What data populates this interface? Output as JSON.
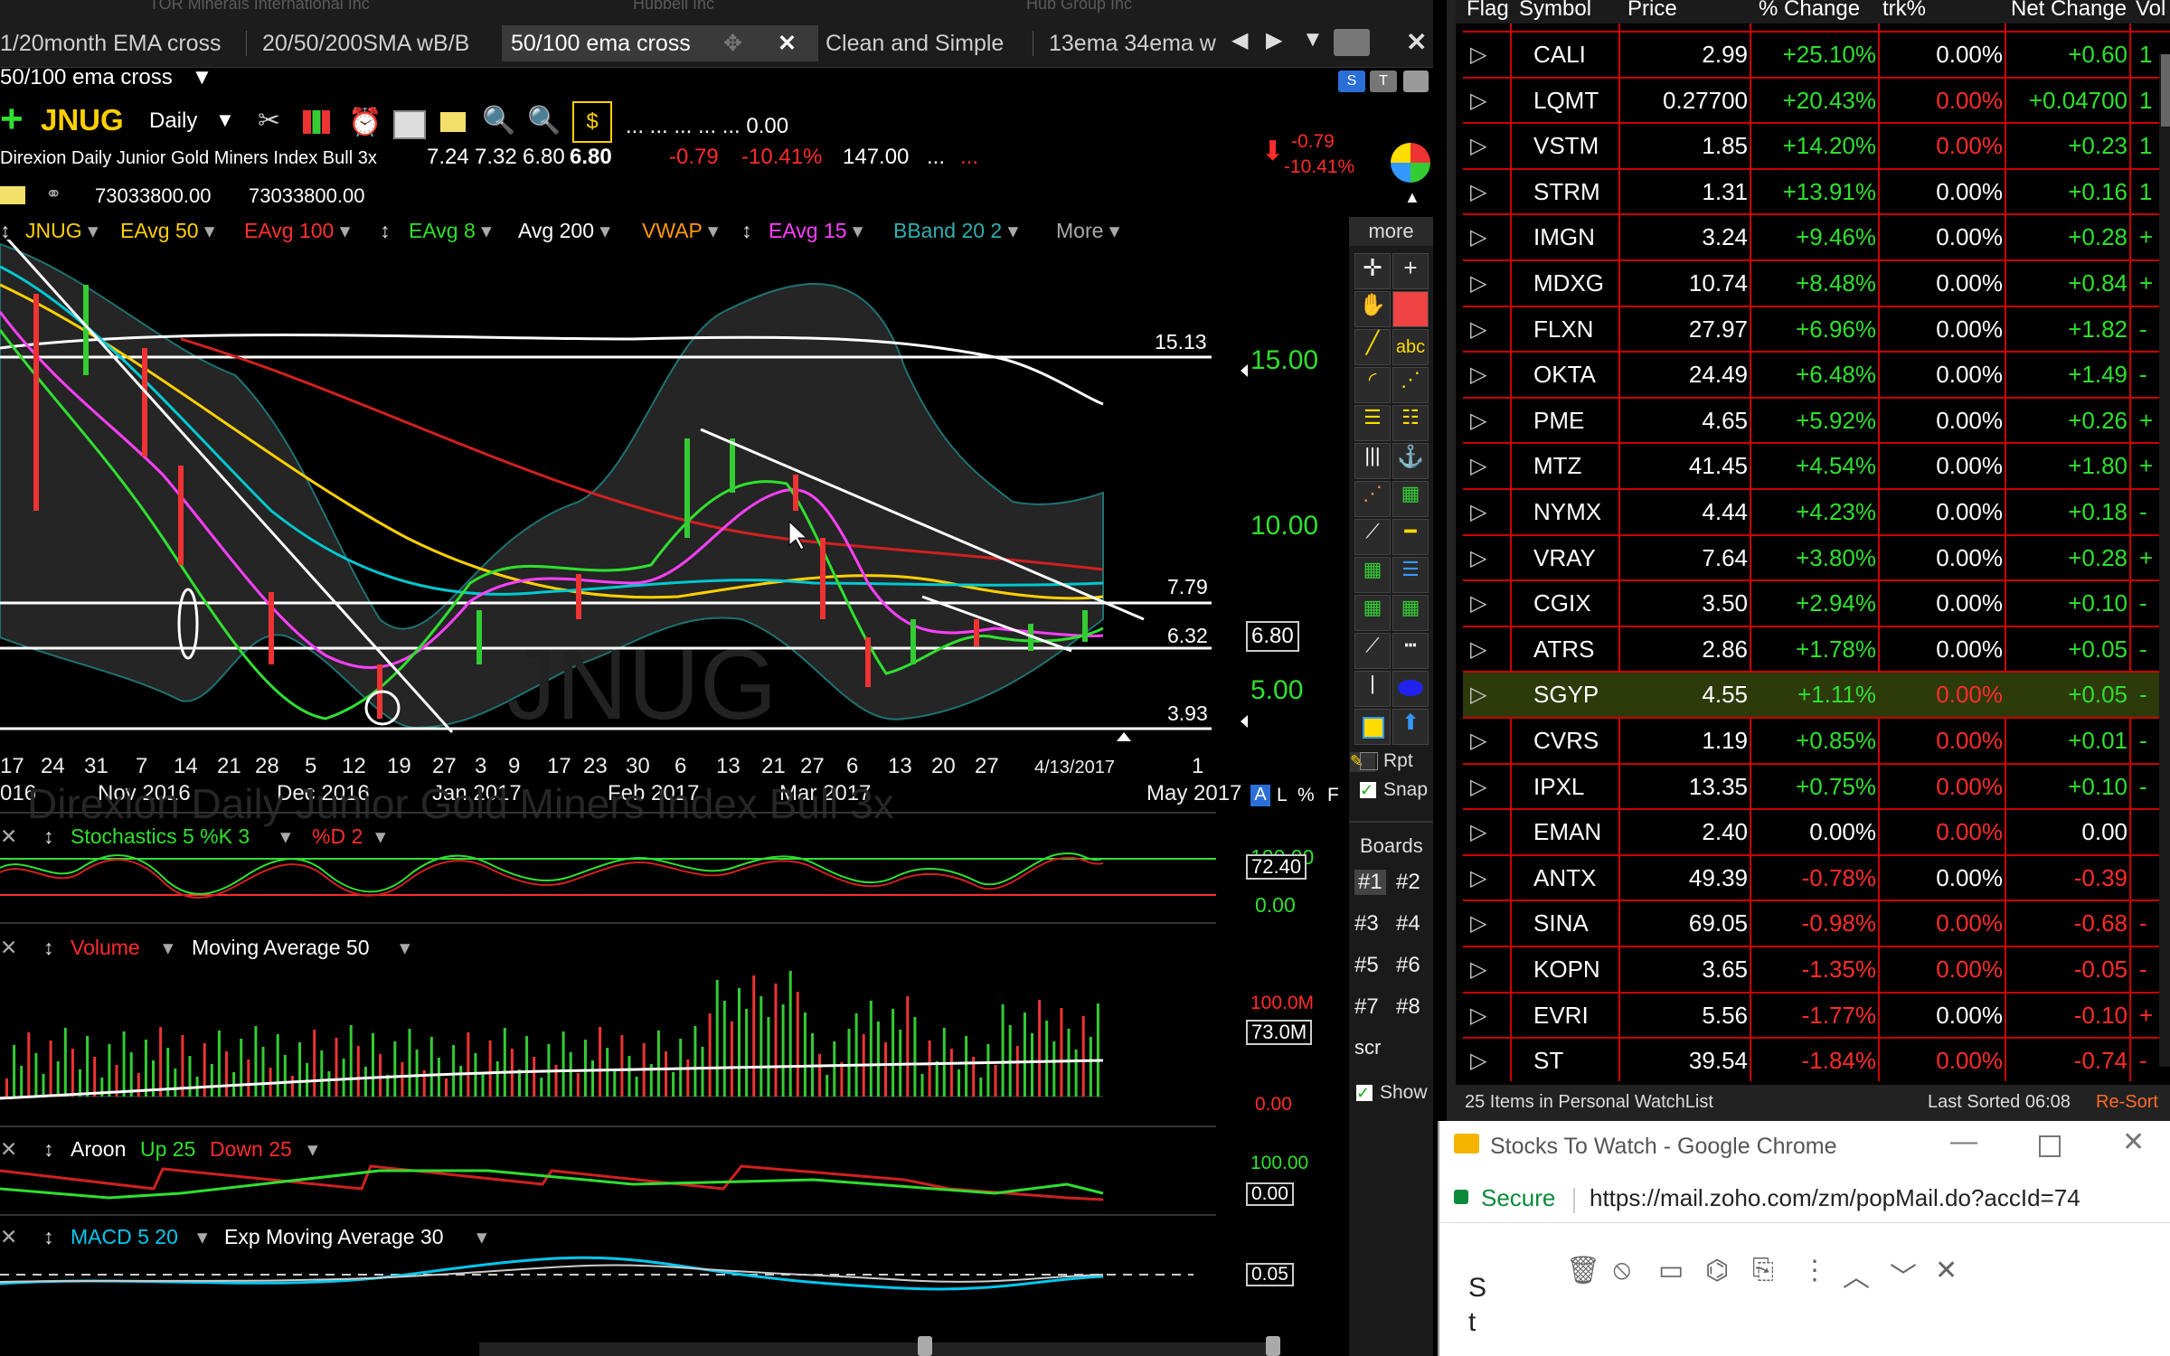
{
  "tabbar": {
    "ghost_titles": [
      "TOR Minerals International Inc",
      "Hubbell Inc",
      "Hub Group Inc"
    ],
    "tabs": [
      {
        "label": "1/20month EMA cross"
      },
      {
        "label": "20/50/200SMA wB/B"
      },
      {
        "label": "50/100 ema cross"
      },
      {
        "label": "Clean and Simple"
      },
      {
        "label": "13ema 34ema w"
      }
    ],
    "tab_close": "✕",
    "nav_prev": "◀",
    "nav_next": "▶",
    "nav_menu": "▼",
    "window_close": "✕"
  },
  "layout_name": "50/100 ema cross",
  "symbol": {
    "ticker": "JNUG",
    "interval": "Daily",
    "ohlc_placeholder": "... ... ... ... ... 0.00",
    "name": "Direxion Daily Junior Gold Miners Index Bull 3x",
    "open": "7.24",
    "high": "7.32",
    "low": "6.80",
    "last": "6.80",
    "change": "-0.79",
    "change_pct": "-10.41%",
    "prev": "147.00",
    "dots": "...",
    "dots_red": "...",
    "volume_a": "73033800.00",
    "volume_b": "73033800.00",
    "badge_change": "-0.79",
    "badge_change_pct": "-10.41%",
    "watermark": "JNUG",
    "watermark_name": "Direxion Daily Junior Gold Miners Index Bull 3x"
  },
  "indicators": [
    {
      "label": "JNUG",
      "color": "#ffd000"
    },
    {
      "label": "EAvg 50",
      "color": "#ffd000"
    },
    {
      "label": "EAvg 100",
      "color": "#ff3030"
    },
    {
      "label": "EAvg 8",
      "color": "#30e030"
    },
    {
      "label": "Avg 200",
      "color": "#ffffff"
    },
    {
      "label": "VWAP",
      "color": "#ff9a00"
    },
    {
      "label": "EAvg 15",
      "color": "#ff40ff"
    },
    {
      "label": "BBand 20 2",
      "color": "#2fb0b0"
    },
    {
      "label": "More",
      "color": "#aaaaaa"
    }
  ],
  "price_axis": {
    "labels": [
      "15.00",
      "10.00",
      "5.00"
    ],
    "level_15_13": "15.13",
    "level_7_79": "7.79",
    "level_6_32": "6.32",
    "level_3_93": "3.93",
    "last_box": "6.80"
  },
  "dates_row1": [
    "17",
    "24",
    "31",
    "7",
    "14",
    "21",
    "28",
    "5",
    "12",
    "19",
    "27",
    "3",
    "9",
    "17",
    "23",
    "30",
    "6",
    "13",
    "21",
    "27",
    "6",
    "13",
    "20",
    "27",
    "4/13/2017",
    "1"
  ],
  "dates_row2": [
    "016",
    "Nov 2016",
    "Dec 2016",
    "Jan 2017",
    "Feb 2017",
    "Mar 2017",
    "May 2017"
  ],
  "axis_modes": {
    "a": "A",
    "l": "L",
    "pct": "%",
    "f": "F"
  },
  "stochastics": {
    "label": "Stochastics 5 %K 3",
    "d_label": "%D 2",
    "top": "100.00",
    "current": "72.40",
    "bottom": "0.00"
  },
  "volume": {
    "label": "Volume",
    "ma_label": "Moving Average 50",
    "top": "100.0M",
    "current": "73.0M",
    "bottom": "0.00"
  },
  "aroon": {
    "label": "Aroon",
    "up": "Up 25",
    "down": "Down 25",
    "top": "100.00",
    "current": "0.00",
    "bottom": "0.00"
  },
  "macd": {
    "label": "MACD 5 20",
    "ema_label": "Exp Moving Average 30",
    "current": "0.05"
  },
  "tools": {
    "more": "more",
    "rpt": "Rpt",
    "snap": "Snap",
    "boards": "Boards",
    "show": "Show",
    "scr": "scr",
    "abc": "abc",
    "board_items": [
      "#1",
      "#2",
      "#3",
      "#4",
      "#5",
      "#6",
      "#7",
      "#8"
    ]
  },
  "watchlist": {
    "headers": [
      "Flag",
      "Symbol",
      "Price",
      "% Change",
      "trk%",
      "Net Change",
      "Vol"
    ],
    "rows": [
      {
        "symbol": "CALI",
        "price": "2.99",
        "pct": "+25.10%",
        "trk": "0.00%",
        "trk_red": false,
        "net": "+0.60",
        "tail": "1"
      },
      {
        "symbol": "LQMT",
        "price": "0.27700",
        "pct": "+20.43%",
        "trk": "0.00%",
        "trk_red": true,
        "net": "+0.04700",
        "tail": "1"
      },
      {
        "symbol": "VSTM",
        "price": "1.85",
        "pct": "+14.20%",
        "trk": "0.00%",
        "trk_red": true,
        "net": "+0.23",
        "tail": "1"
      },
      {
        "symbol": "STRM",
        "price": "1.31",
        "pct": "+13.91%",
        "trk": "0.00%",
        "trk_red": false,
        "net": "+0.16",
        "tail": "1"
      },
      {
        "symbol": "IMGN",
        "price": "3.24",
        "pct": "+9.46%",
        "trk": "0.00%",
        "trk_red": false,
        "net": "+0.28",
        "tail": "+"
      },
      {
        "symbol": "MDXG",
        "price": "10.74",
        "pct": "+8.48%",
        "trk": "0.00%",
        "trk_red": false,
        "net": "+0.84",
        "tail": "+"
      },
      {
        "symbol": "FLXN",
        "price": "27.97",
        "pct": "+6.96%",
        "trk": "0.00%",
        "trk_red": false,
        "net": "+1.82",
        "tail": "-"
      },
      {
        "symbol": "OKTA",
        "price": "24.49",
        "pct": "+6.48%",
        "trk": "0.00%",
        "trk_red": false,
        "net": "+1.49",
        "tail": "-"
      },
      {
        "symbol": "PME",
        "price": "4.65",
        "pct": "+5.92%",
        "trk": "0.00%",
        "trk_red": false,
        "net": "+0.26",
        "tail": "+"
      },
      {
        "symbol": "MTZ",
        "price": "41.45",
        "pct": "+4.54%",
        "trk": "0.00%",
        "trk_red": false,
        "net": "+1.80",
        "tail": "+"
      },
      {
        "symbol": "NYMX",
        "price": "4.44",
        "pct": "+4.23%",
        "trk": "0.00%",
        "trk_red": false,
        "net": "+0.18",
        "tail": "-"
      },
      {
        "symbol": "VRAY",
        "price": "7.64",
        "pct": "+3.80%",
        "trk": "0.00%",
        "trk_red": false,
        "net": "+0.28",
        "tail": "+"
      },
      {
        "symbol": "CGIX",
        "price": "3.50",
        "pct": "+2.94%",
        "trk": "0.00%",
        "trk_red": false,
        "net": "+0.10",
        "tail": "-"
      },
      {
        "symbol": "ATRS",
        "price": "2.86",
        "pct": "+1.78%",
        "trk": "0.00%",
        "trk_red": false,
        "net": "+0.05",
        "tail": "-"
      },
      {
        "symbol": "SGYP",
        "price": "4.55",
        "pct": "+1.11%",
        "trk": "0.00%",
        "trk_red": true,
        "net": "+0.05",
        "tail": "-"
      },
      {
        "symbol": "CVRS",
        "price": "1.19",
        "pct": "+0.85%",
        "trk": "0.00%",
        "trk_red": true,
        "net": "+0.01",
        "tail": "-"
      },
      {
        "symbol": "IPXL",
        "price": "13.35",
        "pct": "+0.75%",
        "trk": "0.00%",
        "trk_red": true,
        "net": "+0.10",
        "tail": "-"
      },
      {
        "symbol": "EMAN",
        "price": "2.40",
        "pct": "0.00%",
        "trk": "0.00%",
        "trk_red": true,
        "net": "0.00",
        "tail": ""
      },
      {
        "symbol": "ANTX",
        "price": "49.39",
        "pct": "-0.78%",
        "trk": "0.00%",
        "trk_red": false,
        "net": "-0.39",
        "tail": ""
      },
      {
        "symbol": "SINA",
        "price": "69.05",
        "pct": "-0.98%",
        "trk": "0.00%",
        "trk_red": true,
        "net": "-0.68",
        "tail": "-"
      },
      {
        "symbol": "KOPN",
        "price": "3.65",
        "pct": "-1.35%",
        "trk": "0.00%",
        "trk_red": true,
        "net": "-0.05",
        "tail": "-"
      },
      {
        "symbol": "EVRI",
        "price": "5.56",
        "pct": "-1.77%",
        "trk": "0.00%",
        "trk_red": false,
        "net": "-0.10",
        "tail": "+"
      },
      {
        "symbol": "ST",
        "price": "39.54",
        "pct": "-1.84%",
        "trk": "0.00%",
        "trk_red": true,
        "net": "-0.74",
        "tail": "-"
      }
    ],
    "highlighted_row": "SGYP",
    "footer_left": "25 Items in Personal WatchList",
    "footer_sorted": "Last Sorted 06:08",
    "footer_resort": "Re-Sort"
  },
  "chrome": {
    "title": "Stocks To Watch - Google Chrome",
    "secure": "Secure",
    "url": "https://mail.zoho.com/zm/popMail.do?accId=74",
    "body_a": "S",
    "body_b": "t"
  },
  "colors": {
    "positive": "#2fe02f",
    "negative": "#ff2b2b",
    "accent": "#ffd000"
  }
}
